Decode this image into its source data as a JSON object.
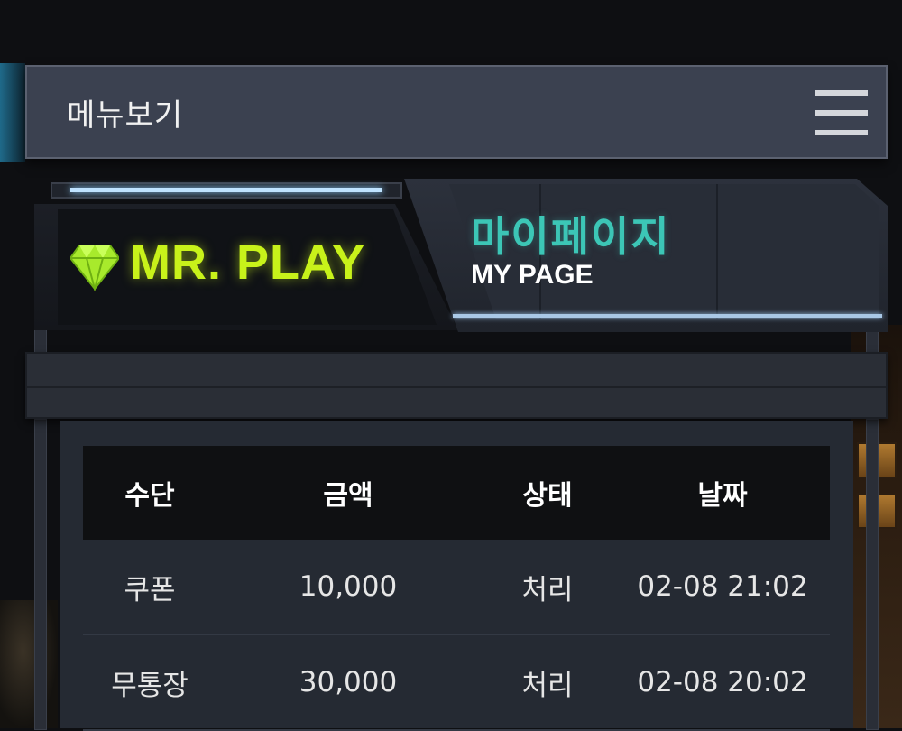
{
  "menu": {
    "label": "메뉴보기",
    "icon": "hamburger-icon"
  },
  "sign": {
    "brand": "MR. PLAY",
    "brand_icon": "diamond-icon",
    "title": "마이페이지",
    "subtitle": "MY PAGE"
  },
  "colors": {
    "brand": "#c8f21a",
    "title": "#3cc6b6",
    "accent_light": "#bfe3ff"
  },
  "table": {
    "headers": [
      "수단",
      "금액",
      "상태",
      "날짜"
    ],
    "rows": [
      [
        "쿠폰",
        "10,000",
        "처리",
        "02-08 21:02"
      ],
      [
        "무통장",
        "30,000",
        "처리",
        "02-08 20:02"
      ]
    ]
  }
}
